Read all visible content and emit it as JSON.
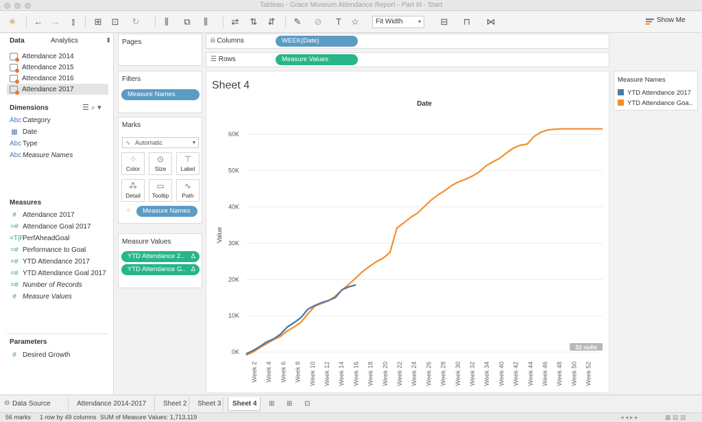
{
  "window": {
    "title": "Tableau - Grace Museum Attendance Report - Part III - Start"
  },
  "toolbar": {
    "fit": "Fit Width",
    "show_me": "Show Me"
  },
  "data_pane": {
    "tab_data": "Data",
    "tab_analytics": "Analytics",
    "sources": [
      "Attendance 2014",
      "Attendance 2015",
      "Attendance 2016",
      "Attendance 2017"
    ],
    "dimensions_title": "Dimensions",
    "dimensions": [
      {
        "icon": "Abc",
        "label": "Category"
      },
      {
        "icon": "▦",
        "label": "Date"
      },
      {
        "icon": "Abc",
        "label": "Type"
      },
      {
        "icon": "Abc",
        "label": "Measure Names"
      }
    ],
    "measures_title": "Measures",
    "measures": [
      {
        "icon": "#",
        "label": "Attendance 2017"
      },
      {
        "icon": "=#",
        "label": "Attendance Goal 2017"
      },
      {
        "icon": "=T|F",
        "label": "PerfAheadGoal"
      },
      {
        "icon": "=#",
        "label": "Performance to Goal"
      },
      {
        "icon": "=#",
        "label": "YTD Attendance 2017"
      },
      {
        "icon": "=#",
        "label": "YTD Attendance Goal 2017"
      },
      {
        "icon": "=#",
        "label": "Number of Records"
      },
      {
        "icon": "#",
        "label": "Measure Values"
      }
    ],
    "parameters_title": "Parameters",
    "parameters": [
      {
        "icon": "#",
        "label": "Desired Growth"
      }
    ]
  },
  "shelves": {
    "pages": "Pages",
    "filters": "Filters",
    "filter_pill": "Measure Names",
    "marks": "Marks",
    "mark_type": "Automatic",
    "mark_buttons": [
      "Color",
      "Size",
      "Label",
      "Detail",
      "Tooltip",
      "Path"
    ],
    "marks_pill": "Measure Names",
    "measure_values": "Measure Values",
    "mv_pills": [
      "YTD Attendance 2..",
      "YTD Attendance G.."
    ],
    "columns": "Columns",
    "columns_pill": "WEEK(Date)",
    "rows": "Rows",
    "rows_pill": "Measure Values"
  },
  "sheet": {
    "title": "Sheet 4",
    "nulls_badge": "32 nulls"
  },
  "legend": {
    "title": "Measure Names",
    "items": [
      {
        "label": "YTD Attendance 2017",
        "color": "#4e79a7"
      },
      {
        "label": "YTD Attendance Goa..",
        "color": "#f28e2b"
      }
    ]
  },
  "chart_data": {
    "type": "line",
    "title": "Date",
    "xlabel": "",
    "ylabel": "Value",
    "ylim": [
      -1500,
      66000
    ],
    "yticks": [
      0,
      10000,
      20000,
      30000,
      40000,
      50000,
      60000
    ],
    "ytick_labels": [
      "0K",
      "10K",
      "20K",
      "30K",
      "40K",
      "50K",
      "60K"
    ],
    "x_tick_labels": [
      "Week 2",
      "Week 4",
      "Week 6",
      "Week 8",
      "Week 10",
      "Week 12",
      "Week 14",
      "Week 16",
      "Week 18",
      "Week 20",
      "Week 22",
      "Week 24",
      "Week 26",
      "Week 28",
      "Week 30",
      "Week 32",
      "Week 34",
      "Week 40",
      "Week 42",
      "Week 44",
      "Week 46",
      "Week 48",
      "Week 50",
      "Week 52"
    ],
    "series": [
      {
        "name": "YTD Attendance 2017",
        "color": "#4e79a7",
        "x": [
          1,
          2,
          3,
          4,
          5,
          6,
          7,
          8,
          9,
          10,
          11,
          12,
          13,
          14,
          15,
          16,
          17
        ],
        "values": [
          -500,
          400,
          1500,
          2800,
          3600,
          4900,
          6900,
          8100,
          9500,
          11800,
          12800,
          13600,
          14200,
          15000,
          17200,
          18000,
          18500
        ]
      },
      {
        "name": "YTD Attendance Goal 2017",
        "color": "#f28e2b",
        "x": [
          1,
          2,
          3,
          4,
          5,
          6,
          7,
          8,
          9,
          10,
          11,
          12,
          13,
          14,
          15,
          16,
          17,
          18,
          19,
          20,
          21,
          22,
          23,
          24,
          25,
          26,
          27,
          28,
          29,
          30,
          31,
          32,
          33,
          34,
          35,
          36,
          37,
          38,
          39,
          40,
          41,
          42,
          43,
          44,
          45,
          46,
          47,
          48,
          49,
          50,
          51,
          52,
          53
        ],
        "values": [
          -900,
          0,
          1200,
          2300,
          3400,
          4300,
          5800,
          6900,
          8200,
          10500,
          12600,
          13400,
          14100,
          15400,
          17100,
          18700,
          20400,
          22200,
          23600,
          24900,
          25900,
          27500,
          34200,
          35600,
          37100,
          38300,
          40100,
          41900,
          43300,
          44500,
          45900,
          46900,
          47600,
          48500,
          49600,
          51300,
          52400,
          53400,
          54900,
          56200,
          57000,
          57300,
          59400,
          60600,
          61200,
          61400,
          61500,
          61500,
          61500,
          61500,
          61500,
          61500,
          61500
        ]
      }
    ]
  },
  "tabs": [
    "Data Source",
    "Attendance 2014-2017",
    "Sheet 2",
    "Sheet 3",
    "Sheet 4"
  ],
  "active_tab": "Sheet 4",
  "status": {
    "marks": "56 marks",
    "dims": "1 row by 49 columns",
    "sum": "SUM of Measure Values: 1,713,119"
  }
}
